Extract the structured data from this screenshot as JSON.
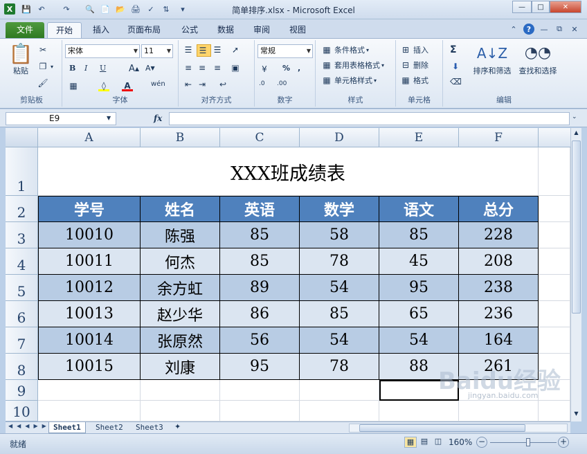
{
  "window": {
    "title": "简单排序.xlsx - Microsoft Excel",
    "app_icon": "excel-icon"
  },
  "tabs": {
    "file": "文件",
    "items": [
      "开始",
      "插入",
      "页面布局",
      "公式",
      "数据",
      "审阅",
      "视图"
    ]
  },
  "ribbon": {
    "clipboard": {
      "paste": "粘贴",
      "label": "剪贴板"
    },
    "font": {
      "name": "宋体",
      "size": "11",
      "label": "字体"
    },
    "alignment": {
      "label": "对齐方式"
    },
    "number": {
      "format": "常规",
      "label": "数字"
    },
    "styles": {
      "conditional": "条件格式",
      "table": "套用表格格式",
      "cell": "单元格样式",
      "label": "样式"
    },
    "cells": {
      "insert": "插入",
      "delete": "删除",
      "format": "格式",
      "label": "单元格"
    },
    "editing": {
      "sort": "排序和筛选",
      "find": "查找和选择",
      "label": "编辑"
    }
  },
  "formula_bar": {
    "name_box": "E9",
    "fx": "fx",
    "value": ""
  },
  "sheet": {
    "columns": [
      "A",
      "B",
      "C",
      "D",
      "E",
      "F"
    ],
    "rows": [
      "1",
      "2",
      "3",
      "4",
      "5",
      "6",
      "7",
      "8",
      "9",
      "10"
    ],
    "title": "XXX班成绩表",
    "headers": [
      "学号",
      "姓名",
      "英语",
      "数学",
      "语文",
      "总分"
    ],
    "data": [
      [
        "10010",
        "陈强",
        "85",
        "58",
        "85",
        "228"
      ],
      [
        "10011",
        "何杰",
        "85",
        "78",
        "45",
        "208"
      ],
      [
        "10012",
        "余方虹",
        "89",
        "54",
        "95",
        "238"
      ],
      [
        "10013",
        "赵少华",
        "86",
        "85",
        "65",
        "236"
      ],
      [
        "10014",
        "张原然",
        "56",
        "54",
        "54",
        "164"
      ],
      [
        "10015",
        "刘康",
        "95",
        "78",
        "88",
        "261"
      ]
    ]
  },
  "sheet_tabs": [
    "Sheet1",
    "Sheet2",
    "Sheet3"
  ],
  "status": {
    "mode": "就绪",
    "zoom": "160%"
  },
  "watermark": {
    "text": "Baidu经验",
    "url": "jingyan.baidu.com"
  }
}
